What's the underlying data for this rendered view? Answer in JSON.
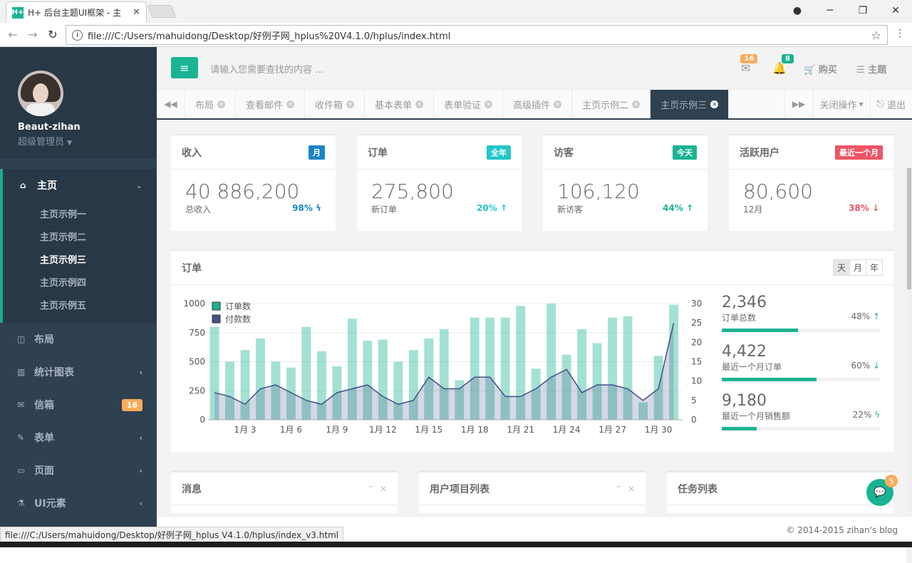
{
  "browser": {
    "tab_title": "H+ 后台主题UI框架 - 主",
    "url": "file:///C:/Users/mahuidong/Desktop/好例子网_hplus%20V4.1.0/hplus/index.html",
    "status_url": "file:///C:/Users/mahuidong/Desktop/好例子网_hplus V4.1.0/hplus/index_v3.html"
  },
  "sidebar": {
    "user_name": "Beaut-zihan",
    "user_role": "超级管理员",
    "home_label": "主页",
    "home_subitems": [
      "主页示例一",
      "主页示例二",
      "主页示例三",
      "主页示例四",
      "主页示例五"
    ],
    "items": [
      {
        "label": "布局"
      },
      {
        "label": "统计图表"
      },
      {
        "label": "信箱",
        "badge": "16"
      },
      {
        "label": "表单"
      },
      {
        "label": "页面"
      },
      {
        "label": "UI元素"
      }
    ]
  },
  "topbar": {
    "search_placeholder": "请输入您需要查找的内容 …",
    "mail_count": "16",
    "alert_count": "8",
    "buy_label": "购买",
    "theme_label": "主题"
  },
  "page_tabs": [
    "布局",
    "查看邮件",
    "收件箱",
    "基本表单",
    "表单验证",
    "高级插件",
    "主页示例二",
    "主页示例三"
  ],
  "tab_actions": {
    "close_ops": "关闭操作",
    "logout": "退出"
  },
  "stats": [
    {
      "title": "收入",
      "badge": "月",
      "badge_color": "#23c6c8",
      "value": "40 886,200",
      "sub": "总收入",
      "pct": "98%",
      "pct_color": "#1c84c6",
      "trend": "bolt"
    },
    {
      "title": "订单",
      "badge": "全年",
      "badge_color": "#23c6c8",
      "value": "275,800",
      "sub": "新订单",
      "pct": "20%",
      "pct_color": "#23c6c8",
      "trend": "up"
    },
    {
      "title": "访客",
      "badge": "今天",
      "badge_color": "#1ab394",
      "value": "106,120",
      "sub": "新访客",
      "pct": "44%",
      "pct_color": "#1ab394",
      "trend": "up"
    },
    {
      "title": "活跃用户",
      "badge": "最近一个月",
      "badge_color": "#ed5565",
      "value": "80,600",
      "sub": "12月",
      "pct": "38%",
      "pct_color": "#ed5565",
      "trend": "down"
    }
  ],
  "order_panel": {
    "title": "订单",
    "ranges": [
      "天",
      "月",
      "年"
    ],
    "kpis": [
      {
        "value": "2,346",
        "label": "订单总数",
        "pct": "48%",
        "trend": "up",
        "fill": 0.48
      },
      {
        "value": "4,422",
        "label": "最近一个月订单",
        "pct": "60%",
        "trend": "down",
        "fill": 0.6
      },
      {
        "value": "9,180",
        "label": "最近一个月销售额",
        "pct": "22%",
        "trend": "bolt",
        "fill": 0.22
      }
    ]
  },
  "chart_data": {
    "type": "bar",
    "x": [
      "1月 1",
      "1月 2",
      "1月 3",
      "1月 4",
      "1月 5",
      "1月 6",
      "1月 7",
      "1月 8",
      "1月 9",
      "1月 10",
      "1月 11",
      "1月 12",
      "1月 13",
      "1月 14",
      "1月 15",
      "1月 16",
      "1月 17",
      "1月 18",
      "1月 19",
      "1月 20",
      "1月 21",
      "1月 22",
      "1月 23",
      "1月 24",
      "1月 25",
      "1月 26",
      "1月 27",
      "1月 28",
      "1月 29",
      "1月 30",
      "1月 31"
    ],
    "tick_labels": [
      "1月 3",
      "1月 6",
      "1月 9",
      "1月 12",
      "1月 15",
      "1月 18",
      "1月 21",
      "1月 24",
      "1月 27",
      "1月 30"
    ],
    "series": [
      {
        "name": "订单数",
        "type": "bar",
        "axis": "left",
        "color": "#1ab394",
        "values": [
          800,
          500,
          600,
          700,
          500,
          450,
          800,
          590,
          460,
          870,
          680,
          690,
          500,
          600,
          700,
          780,
          340,
          880,
          880,
          880,
          980,
          440,
          1000,
          560,
          780,
          660,
          880,
          890,
          150,
          550,
          990
        ]
      },
      {
        "name": "付款数",
        "type": "area",
        "axis": "right",
        "color": "#464f88",
        "values": [
          7,
          6,
          4,
          8,
          9,
          7,
          5,
          4,
          7,
          8,
          9,
          6,
          4,
          5,
          11,
          8,
          8,
          11,
          11,
          6,
          6,
          8,
          11,
          13,
          7,
          9,
          9,
          8,
          5,
          8,
          25
        ]
      }
    ],
    "left_axis": {
      "ylim": [
        0,
        1000
      ],
      "ticks": [
        0,
        250,
        500,
        750,
        1000
      ]
    },
    "right_axis": {
      "ylim": [
        0,
        30
      ],
      "ticks": [
        0,
        5,
        10,
        15,
        20,
        25,
        30
      ]
    },
    "legend": "top-left",
    "grid": true
  },
  "bottom_panels": [
    "消息",
    "用户项目列表",
    "任务列表"
  ],
  "footer": {
    "text": "© 2014-2015 zihan's blog"
  },
  "chat_count": "5"
}
